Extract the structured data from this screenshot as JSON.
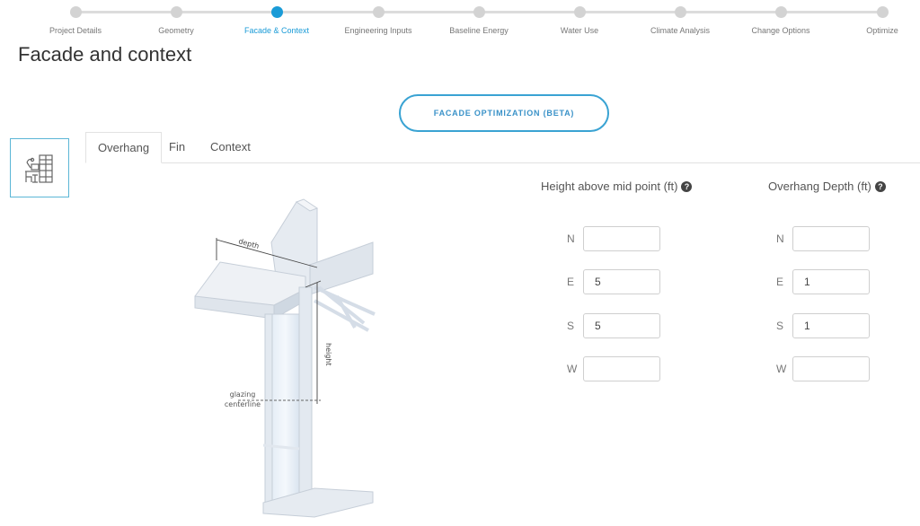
{
  "stepper": {
    "steps": [
      {
        "label": "Project Details",
        "state": "inactive"
      },
      {
        "label": "Geometry",
        "state": "inactive"
      },
      {
        "label": "Facade & Context",
        "state": "active"
      },
      {
        "label": "Engineering Inputs",
        "state": "inactive"
      },
      {
        "label": "Baseline Energy",
        "state": "inactive"
      },
      {
        "label": "Water Use",
        "state": "inactive"
      },
      {
        "label": "Climate Analysis",
        "state": "inactive"
      },
      {
        "label": "Change Options",
        "state": "inactive"
      },
      {
        "label": "Optimize",
        "state": "inactive"
      }
    ],
    "active_color": "#1a9bd7"
  },
  "page": {
    "title": "Facade and context",
    "optimization_button": "FACADE OPTIMIZATION (BETA)",
    "side_icon": "building-room-icon"
  },
  "tabs": [
    {
      "label": "Overhang",
      "active": true
    },
    {
      "label": "Fin",
      "active": false
    },
    {
      "label": "Context",
      "active": false
    }
  ],
  "diagram": {
    "labels": {
      "depth": "depth",
      "height": "height",
      "glazing_line1": "glazing",
      "glazing_line2": "centerline"
    }
  },
  "form": {
    "height_column": {
      "header": "Height above mid point (ft)",
      "help_icon": "question-circle-icon",
      "rows": [
        {
          "dir": "N",
          "value": ""
        },
        {
          "dir": "E",
          "value": "5"
        },
        {
          "dir": "S",
          "value": "5"
        },
        {
          "dir": "W",
          "value": ""
        }
      ]
    },
    "depth_column": {
      "header": "Overhang Depth (ft)",
      "help_icon": "question-circle-icon",
      "rows": [
        {
          "dir": "N",
          "value": ""
        },
        {
          "dir": "E",
          "value": "1"
        },
        {
          "dir": "S",
          "value": "1"
        },
        {
          "dir": "W",
          "value": ""
        }
      ]
    },
    "help_glyph": "?"
  }
}
